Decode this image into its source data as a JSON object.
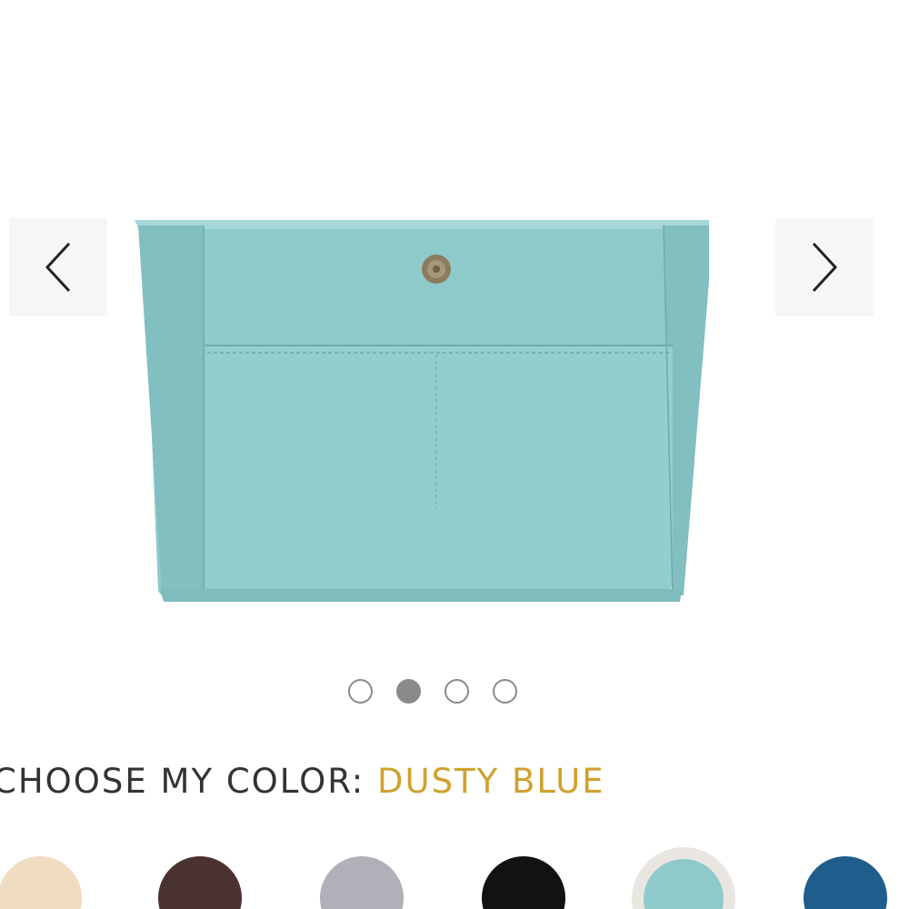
{
  "gallery": {
    "product_color": "#8fcacb",
    "prev_icon": "chevron-left-icon",
    "next_icon": "chevron-right-icon",
    "slides": 4,
    "active_slide": 2
  },
  "color_picker": {
    "label": "CHOOSE MY COLOR:",
    "selected_name": "DUSTY BLUE",
    "label_color": "#333333",
    "selected_color": "#d0a12f",
    "swatches": [
      {
        "color": "#f0dcc0"
      },
      {
        "color": "#4a3230"
      },
      {
        "color": "#b3afb9"
      },
      {
        "color": "#121212"
      },
      {
        "color": "#8fcacb",
        "selected": true
      },
      {
        "color": "#1f5d8c"
      }
    ]
  }
}
